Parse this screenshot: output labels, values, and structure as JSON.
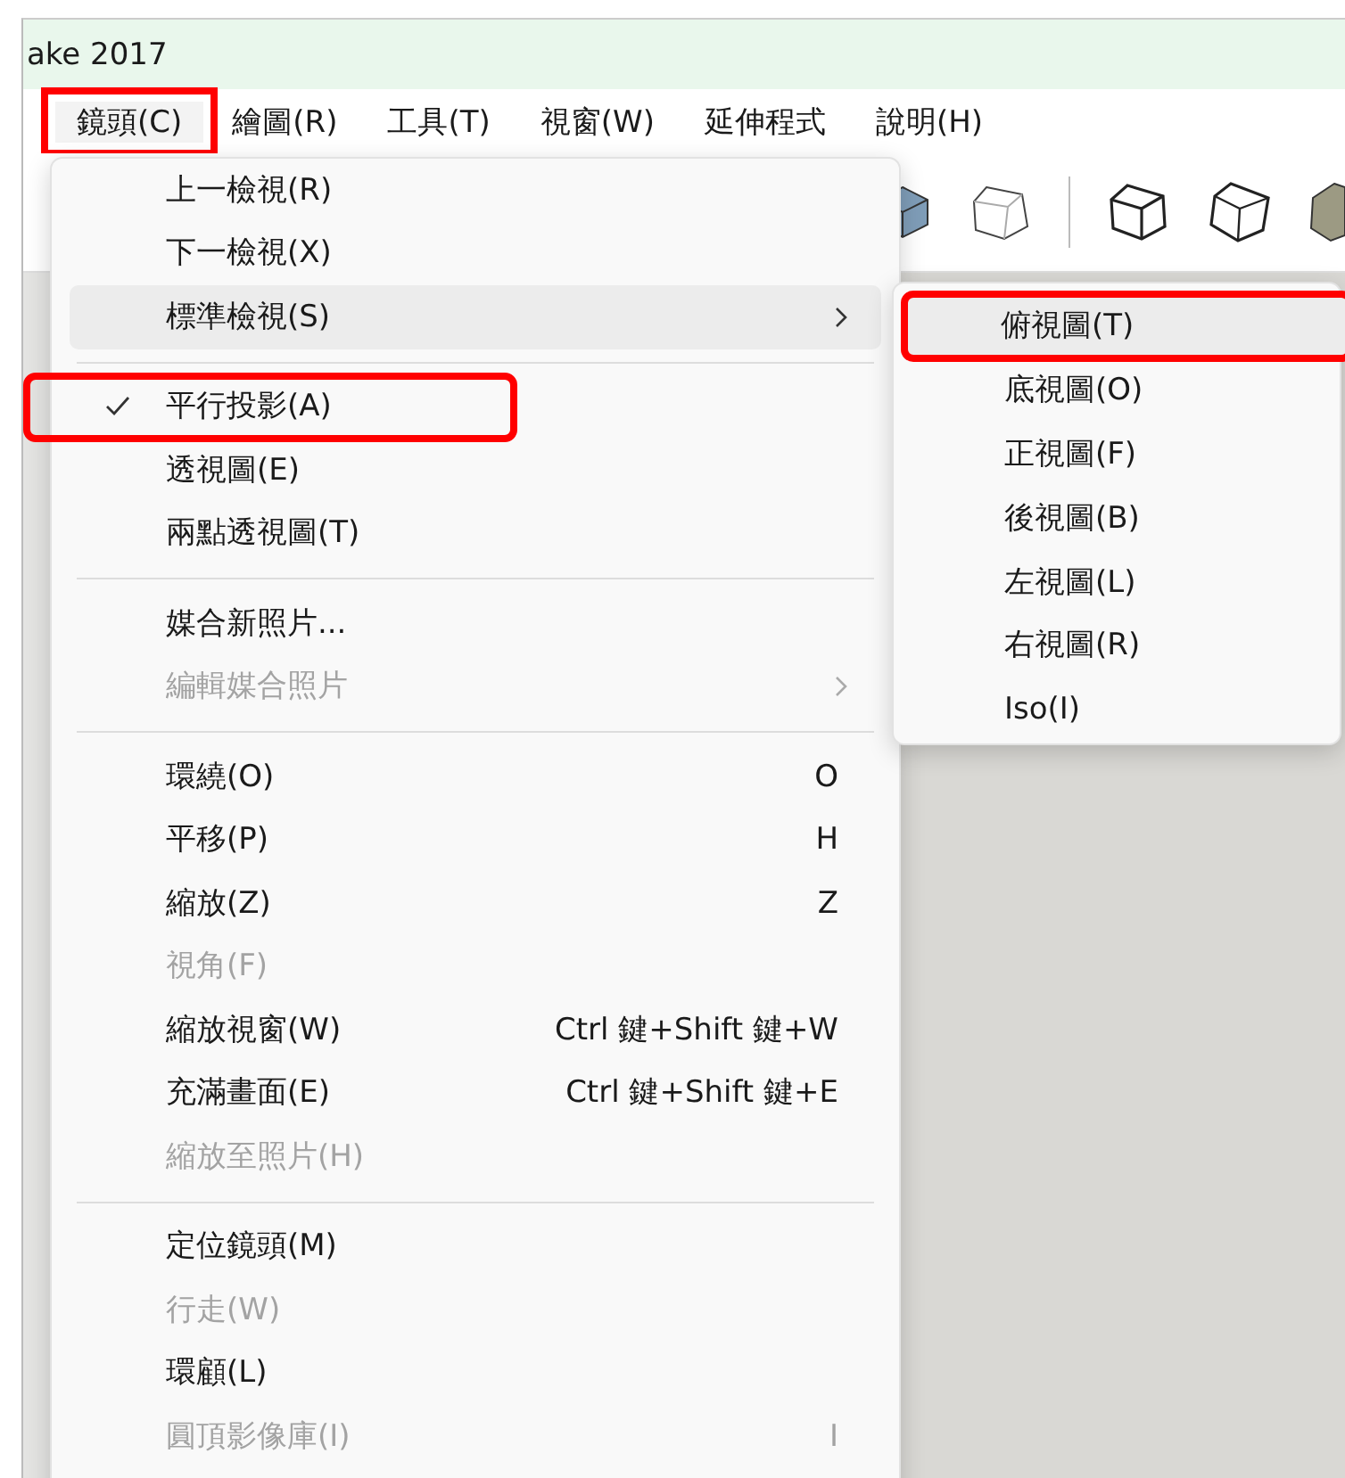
{
  "window": {
    "title": "ake 2017"
  },
  "menubar": [
    {
      "label": "鏡頭(C)",
      "selected": true,
      "highlighted": true
    },
    {
      "label": "繪圖(R)",
      "selected": false,
      "highlighted": false
    },
    {
      "label": "工具(T)",
      "selected": false,
      "highlighted": false
    },
    {
      "label": "視窗(W)",
      "selected": false,
      "highlighted": false
    },
    {
      "label": "延伸程式",
      "selected": false,
      "highlighted": false
    },
    {
      "label": "說明(H)",
      "selected": false,
      "highlighted": false
    }
  ],
  "menu": [
    {
      "kind": "item",
      "label": "上一檢視(R)",
      "checked": false,
      "disabled": false,
      "submenu": false,
      "selected": false,
      "highlighted": false
    },
    {
      "kind": "item",
      "label": "下一檢視(X)",
      "checked": false,
      "disabled": false,
      "submenu": false,
      "selected": false,
      "highlighted": false
    },
    {
      "kind": "item",
      "label": "標準檢視(S)",
      "checked": false,
      "disabled": false,
      "submenu": true,
      "selected": true,
      "highlighted": false
    },
    {
      "kind": "separator"
    },
    {
      "kind": "item",
      "label": "平行投影(A)",
      "checked": true,
      "disabled": false,
      "submenu": false,
      "selected": false,
      "highlighted": true
    },
    {
      "kind": "item",
      "label": "透視圖(E)",
      "checked": false,
      "disabled": false,
      "submenu": false,
      "selected": false,
      "highlighted": false
    },
    {
      "kind": "item",
      "label": "兩點透視圖(T)",
      "checked": false,
      "disabled": false,
      "submenu": false,
      "selected": false,
      "highlighted": false
    },
    {
      "kind": "separator"
    },
    {
      "kind": "item",
      "label": "媒合新照片...",
      "checked": false,
      "disabled": false,
      "submenu": false,
      "selected": false,
      "highlighted": false
    },
    {
      "kind": "item",
      "label": "編輯媒合照片",
      "checked": false,
      "disabled": true,
      "submenu": true,
      "selected": false,
      "highlighted": false
    },
    {
      "kind": "separator"
    },
    {
      "kind": "item",
      "label": "環繞(O)",
      "shortcut": "O",
      "checked": false,
      "disabled": false,
      "submenu": false,
      "selected": false,
      "highlighted": false
    },
    {
      "kind": "item",
      "label": "平移(P)",
      "shortcut": "H",
      "checked": false,
      "disabled": false,
      "submenu": false,
      "selected": false,
      "highlighted": false
    },
    {
      "kind": "item",
      "label": "縮放(Z)",
      "shortcut": "Z",
      "checked": false,
      "disabled": false,
      "submenu": false,
      "selected": false,
      "highlighted": false
    },
    {
      "kind": "item",
      "label": "視角(F)",
      "checked": false,
      "disabled": true,
      "submenu": false,
      "selected": false,
      "highlighted": false
    },
    {
      "kind": "item",
      "label": "縮放視窗(W)",
      "shortcut": "Ctrl 鍵+Shift 鍵+W",
      "checked": false,
      "disabled": false,
      "submenu": false,
      "selected": false,
      "highlighted": false
    },
    {
      "kind": "item",
      "label": "充滿畫面(E)",
      "shortcut": "Ctrl 鍵+Shift 鍵+E",
      "checked": false,
      "disabled": false,
      "submenu": false,
      "selected": false,
      "highlighted": false
    },
    {
      "kind": "item",
      "label": "縮放至照片(H)",
      "checked": false,
      "disabled": true,
      "submenu": false,
      "selected": false,
      "highlighted": false
    },
    {
      "kind": "separator"
    },
    {
      "kind": "item",
      "label": "定位鏡頭(M)",
      "checked": false,
      "disabled": false,
      "submenu": false,
      "selected": false,
      "highlighted": false
    },
    {
      "kind": "item",
      "label": "行走(W)",
      "checked": false,
      "disabled": true,
      "submenu": false,
      "selected": false,
      "highlighted": false
    },
    {
      "kind": "item",
      "label": "環顧(L)",
      "checked": false,
      "disabled": false,
      "submenu": false,
      "selected": false,
      "highlighted": false
    },
    {
      "kind": "item",
      "label": "圓頂影像庫(I)",
      "shortcut": "I",
      "checked": false,
      "disabled": true,
      "submenu": false,
      "selected": false,
      "highlighted": false
    }
  ],
  "submenu": [
    {
      "label": "俯視圖(T)",
      "selected": true,
      "highlighted": true
    },
    {
      "label": "底視圖(O)",
      "selected": false,
      "highlighted": false
    },
    {
      "label": "正視圖(F)",
      "selected": false,
      "highlighted": false
    },
    {
      "label": "後視圖(B)",
      "selected": false,
      "highlighted": false
    },
    {
      "label": "左視圖(L)",
      "selected": false,
      "highlighted": false
    },
    {
      "label": "右視圖(R)",
      "selected": false,
      "highlighted": false
    },
    {
      "label": "Iso(I)",
      "selected": false,
      "highlighted": false
    }
  ]
}
